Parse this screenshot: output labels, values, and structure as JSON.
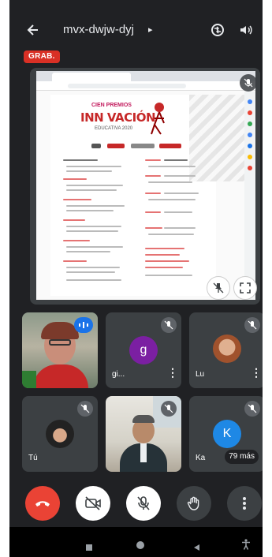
{
  "header": {
    "meeting_code": "mvx-dwjw-dyj",
    "recording_badge": "GRAB."
  },
  "participants": [
    {
      "name": "",
      "avatar_letter": ""
    },
    {
      "name": "gi...",
      "avatar_letter": "g",
      "avatar_color": "#7b1fa2"
    },
    {
      "name": "Lu",
      "avatar_letter": ""
    },
    {
      "name": "Tú",
      "avatar_letter": ""
    },
    {
      "name": "",
      "avatar_letter": ""
    },
    {
      "name": "Ka",
      "avatar_letter": "K",
      "avatar_color": "#1e88e5",
      "more_label": "79 más"
    }
  ],
  "presentation": {
    "logo_top": "CIEN PREMIOS",
    "logo_main": "INN VACIÓN",
    "logo_sub": "EDUCATIVA 2020"
  },
  "colors": {
    "background": "#202124",
    "end_call": "#ea4335",
    "record": "#d93025"
  }
}
